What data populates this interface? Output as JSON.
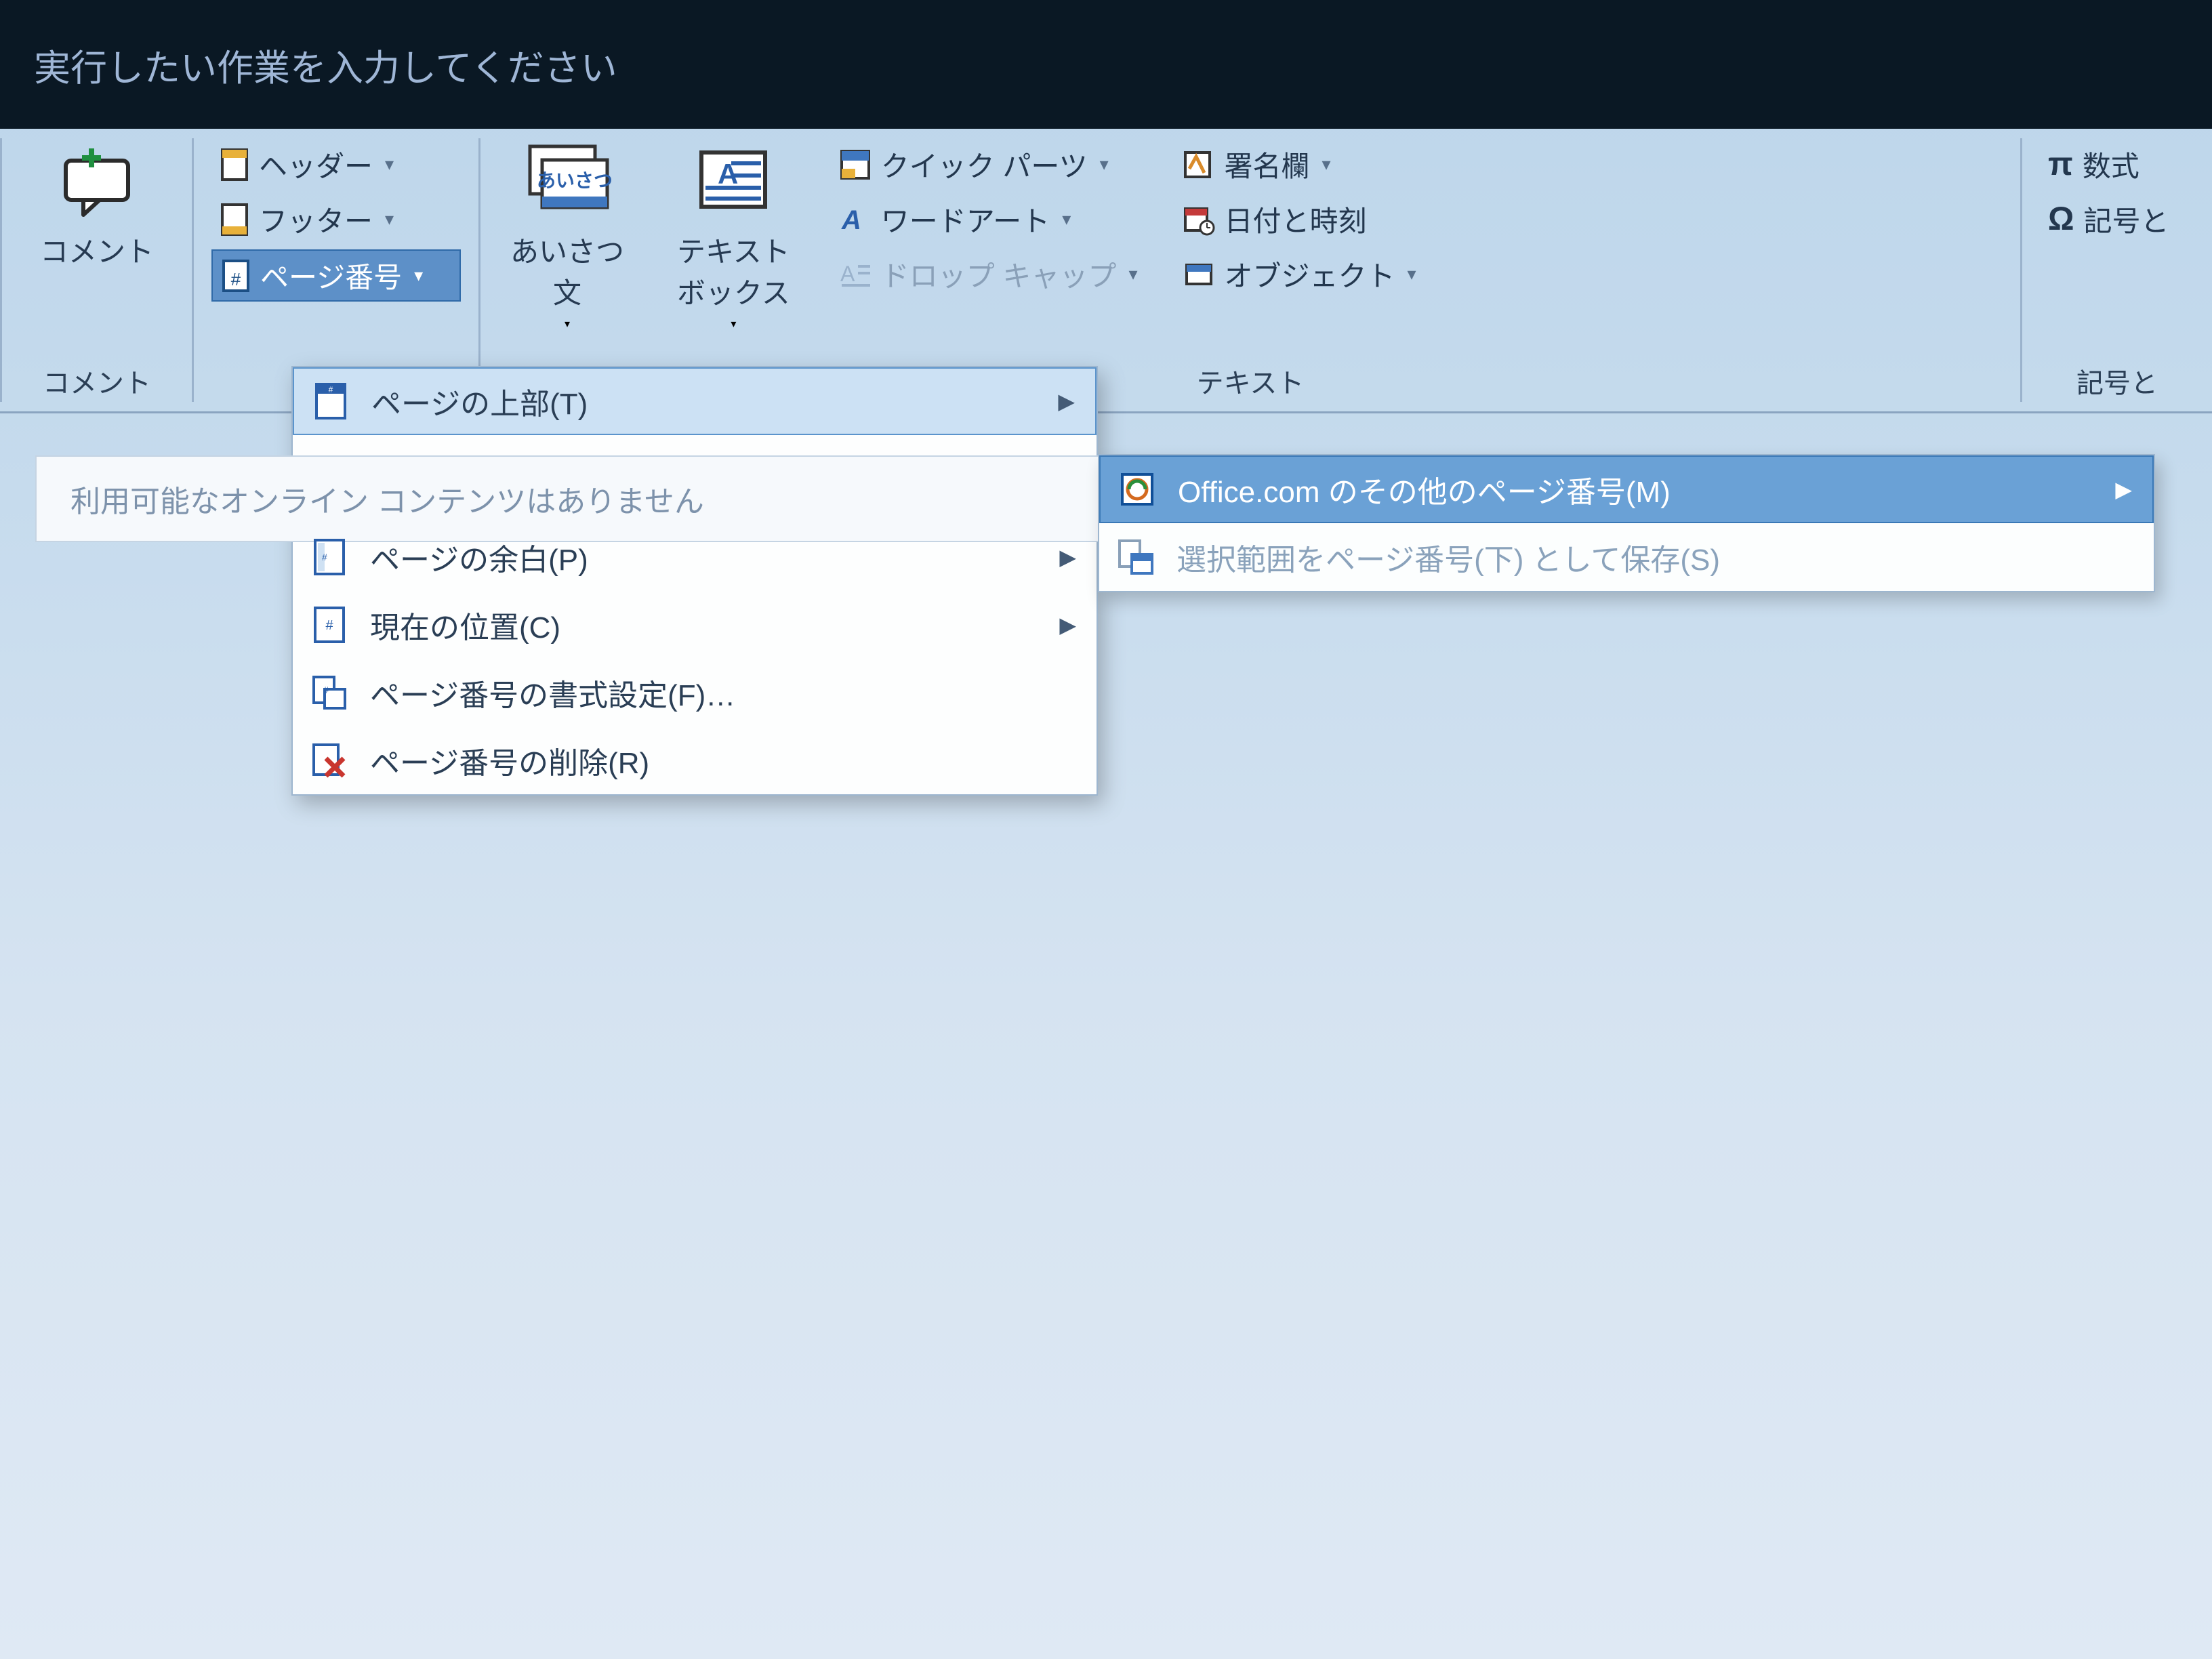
{
  "tell_me": {
    "placeholder": "実行したい作業を入力してください"
  },
  "ribbon": {
    "comment": {
      "label": "コメント",
      "group_label": "コメント"
    },
    "header_footer": {
      "header": "ヘッダー",
      "footer": "フッター",
      "page_number": "ページ番号"
    },
    "text_group": {
      "greeting_top": "あいさつ",
      "greeting_btn": "あいさつ\n文",
      "textbox_btn": "テキスト\nボックス",
      "quick_parts": "クイック パーツ",
      "wordart": "ワードアート",
      "dropcap": "ドロップ キャップ",
      "signature": "署名欄",
      "datetime": "日付と時刻",
      "object": "オブジェクト",
      "group_label": "テキスト"
    },
    "symbols": {
      "equation": "数式",
      "symbol": "記号と",
      "group_label": "記号と"
    }
  },
  "menu1": {
    "top_of_page": "ページの上部(T)",
    "no_online_banner": "利用可能なオンライン コンテンツはありません",
    "page_margin": "ページの余白(P)",
    "current_position": "現在の位置(C)",
    "format": "ページ番号の書式設定(F)…",
    "remove": "ページ番号の削除(R)"
  },
  "submenu": {
    "office_more": "Office.com のその他のページ番号(M)",
    "save_selection": "選択範囲をページ番号(下) として保存(S)"
  }
}
